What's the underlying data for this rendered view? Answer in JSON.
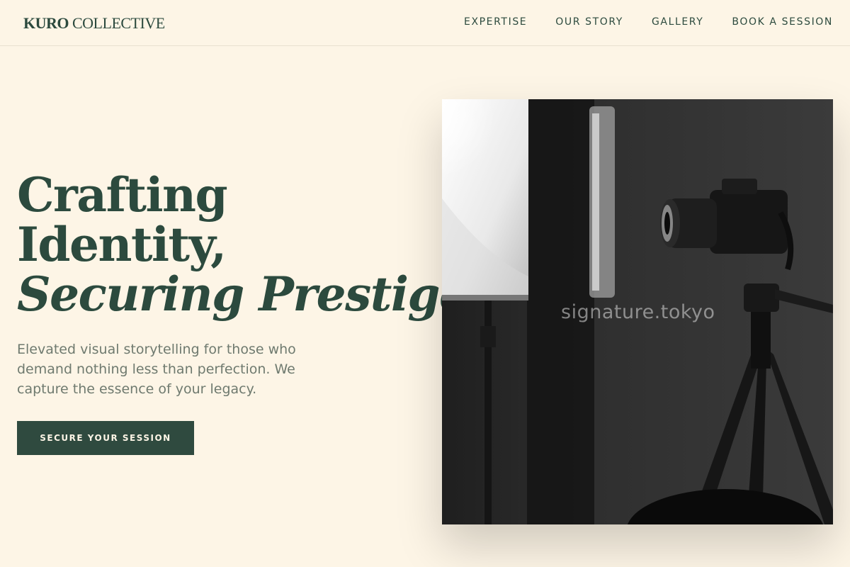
{
  "header": {
    "logo_strong": "KURO",
    "logo_light": "COLLECTIVE",
    "nav": [
      {
        "label": "EXPERTISE"
      },
      {
        "label": "OUR STORY"
      },
      {
        "label": "GALLERY"
      },
      {
        "label": "BOOK A SESSION"
      }
    ]
  },
  "hero": {
    "title_line1": "Crafting",
    "title_line2": "Identity,",
    "title_line3": "Securing Prestige.",
    "description": "Elevated visual storytelling for those who demand nothing less than perfection. We capture the essence of your legacy.",
    "cta_label": "SECURE YOUR SESSION",
    "image_watermark": "signature.tokyo"
  },
  "colors": {
    "background": "#fdf5e6",
    "accent": "#2f4a3f",
    "muted_text": "#6f7a6f"
  }
}
